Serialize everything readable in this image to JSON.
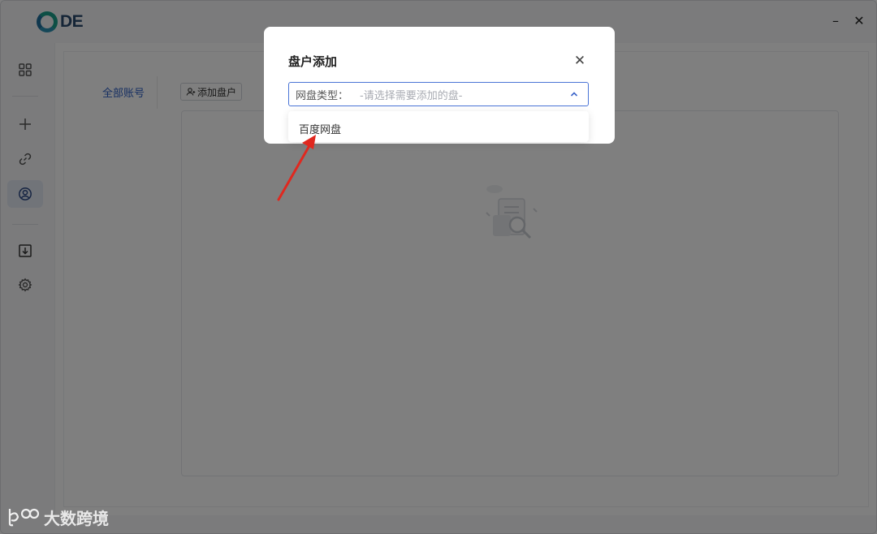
{
  "app": {
    "logo_text": "DE",
    "window_controls": {
      "minimize": "–",
      "close": "✕"
    }
  },
  "sidebar": {
    "items": [
      {
        "name": "apps-grid-icon"
      },
      {
        "name": "plus-icon"
      },
      {
        "name": "link-icon"
      },
      {
        "name": "user-circle-icon",
        "active": true
      },
      {
        "name": "download-icon"
      },
      {
        "name": "gear-icon"
      }
    ]
  },
  "main": {
    "account_tab": "全部账号",
    "add_disk_label": "添加盘户"
  },
  "modal": {
    "title": "盘户添加",
    "close_glyph": "✕",
    "select_label": "网盘类型：",
    "select_placeholder": "-请选择需要添加的盘-",
    "options": [
      "百度网盘"
    ]
  },
  "watermark": {
    "text": "大数跨境"
  },
  "colors": {
    "accent": "#2d5fc4",
    "select_border": "#4a74d6",
    "annotation_arrow": "#e0281f"
  }
}
